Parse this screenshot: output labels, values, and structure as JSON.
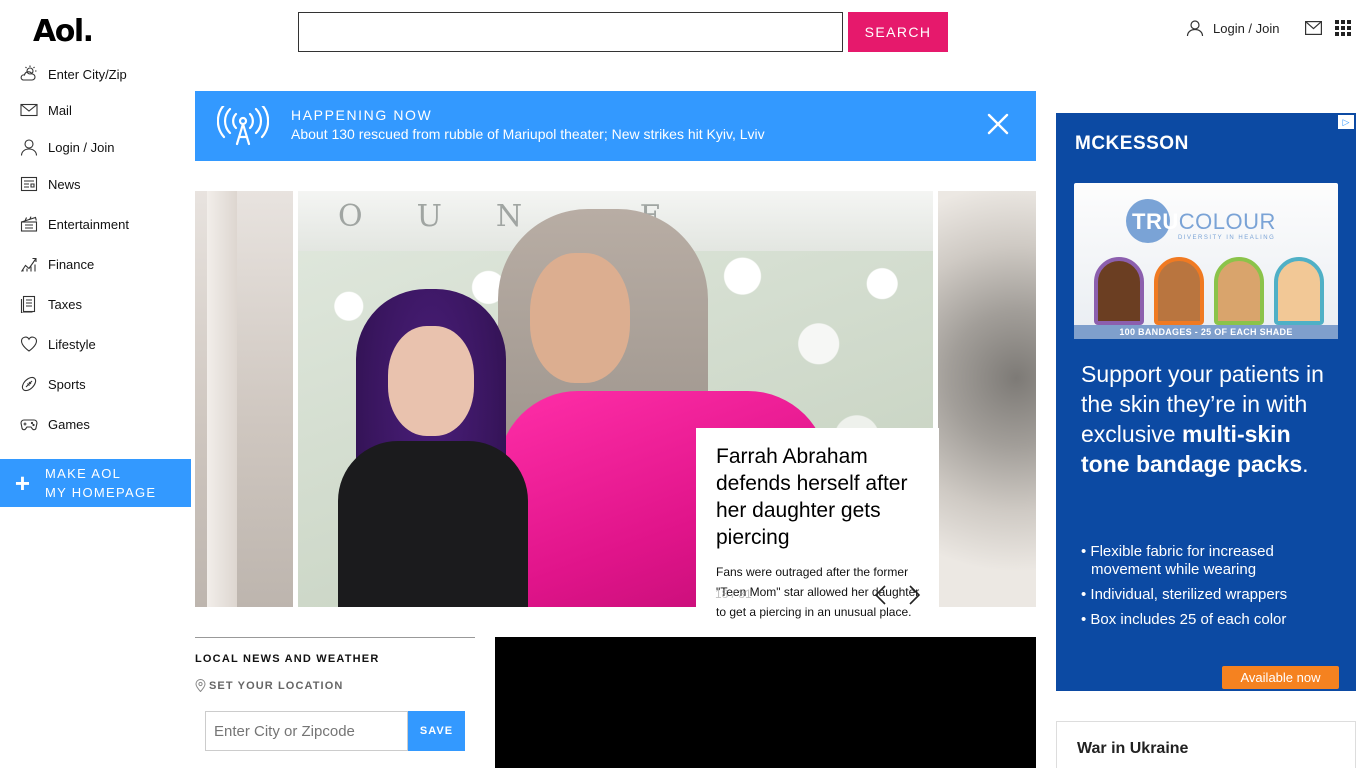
{
  "header": {
    "logo": "Aol.",
    "search": {
      "placeholder": "",
      "button": "SEARCH"
    },
    "login": "Login / Join"
  },
  "sidebar": {
    "items": [
      {
        "label": "Enter City/Zip",
        "icon": "weather-icon"
      },
      {
        "label": "Mail",
        "icon": "mail-icon"
      },
      {
        "label": "Login / Join",
        "icon": "user-icon"
      },
      {
        "label": "News",
        "icon": "newspaper-icon"
      },
      {
        "label": "Entertainment",
        "icon": "clapperboard-icon"
      },
      {
        "label": "Finance",
        "icon": "chart-icon"
      },
      {
        "label": "Taxes",
        "icon": "document-icon"
      },
      {
        "label": "Lifestyle",
        "icon": "heart-icon"
      },
      {
        "label": "Sports",
        "icon": "football-icon"
      },
      {
        "label": "Games",
        "icon": "gamepad-icon"
      }
    ],
    "make_homepage": {
      "line1": "MAKE AOL",
      "line2": "MY HOMEPAGE"
    }
  },
  "happening": {
    "label": "HAPPENING NOW",
    "headline": "About 130 rescued from rubble of Mariupol theater; New strikes hit Kyiv, Lviv"
  },
  "carousel": {
    "wall_letters": "OUN E",
    "title": "Farrah Abraham defends herself after her daughter gets piercing",
    "summary": "Fans were outraged after the former \"Teen Mom\" star allowed her daughter to get a piercing in an unusual place.",
    "counter": "18 / 31"
  },
  "local_news": {
    "title": "LOCAL NEWS AND WEATHER",
    "set_location": "SET YOUR LOCATION",
    "zip_placeholder": "Enter City or Zipcode",
    "save": "SAVE"
  },
  "ad": {
    "brand": "MCKESSON",
    "product_name_1": "TRU",
    "product_name_2": "COLOUR",
    "product_tagline": "DIVERSITY IN HEALING",
    "product_bar": "100 BANDAGES - 25 OF EACH SHADE",
    "copy_1": "Support your patients in the skin they’re in with exclusive",
    "copy_2": "multi-skin tone bandage packs",
    "copy_3": ".",
    "bullets": [
      "• Flexible fabric for increased movement while wearing",
      "• Individual, sterilized wrappers",
      "• Box includes 25 of each color"
    ],
    "cta": "Available now",
    "colors": {
      "background": "#0c4aa3",
      "cta": "#f58220"
    }
  },
  "war_section": {
    "title": "War in Ukraine"
  },
  "colors": {
    "accent_pink": "#e6196c",
    "accent_blue": "#3399ff"
  }
}
